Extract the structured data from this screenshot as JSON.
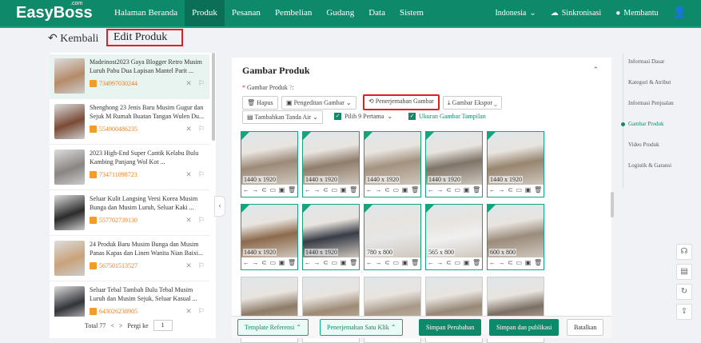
{
  "app": {
    "logo": "EasyBoss",
    "logo_sup": ".com"
  },
  "nav": [
    "Halaman Beranda",
    "Produk",
    "Pesanan",
    "Pembelian",
    "Gudang",
    "Data",
    "Sistem"
  ],
  "top_right": {
    "region": "Indonesia",
    "sync": "Sinkronisasi",
    "help": "Membantu"
  },
  "header": {
    "back": "Kembali",
    "title": "Edit Produk"
  },
  "products": [
    {
      "title": "Madeinost2023 Gaya Blogger Retro Musim Luruh Pabu Dua Lapisan Mantel Parit ...",
      "sku": "734997030244",
      "color": "#b58b6a"
    },
    {
      "title": "Shenghong 23 Jenis Baru Musim Gugur dan Sejuk M Rumah Buatan Tangan Wulen Du...",
      "sku": "554900486235",
      "color": "#7a4b36"
    },
    {
      "title": "2023 High-End Super Cantik Kelabu Bulu Kambing Panjang Wol Kot ...",
      "sku": "734711098723",
      "color": "#8a8583"
    },
    {
      "title": "Seluar Kulit Langsing Versi Korea Musim Bunga dan Musim Luruh, Seluar Kaki ...",
      "sku": "557702739130",
      "color": "#2b2b2b"
    },
    {
      "title": "24 Produk Baru Musim Bunga dan Musim Panas Kapas dan Linen Wanita Nian Baixi...",
      "sku": "567501513527",
      "color": "#c9a27a"
    },
    {
      "title": "Seluar Tebal Tambah Bulu Tebal Musim Luruh dan Musim Sejuk, Seluar Kasual ...",
      "sku": "643026238905",
      "color": "#33343a"
    }
  ],
  "pager": {
    "total": "Total 77",
    "goto": "Pergi ke",
    "page": "1"
  },
  "main": {
    "section_title": "Gambar Produk",
    "field_label": "Gambar Produk",
    "buttons": {
      "delete": "Hapus",
      "edit": "Pengeditan Gambar",
      "translate": "Penerjemahan Gambar",
      "export": "Gambar Ekspor",
      "watermark": "Tambahkan Tanda Air"
    },
    "checks": {
      "first9": "Pilih 9 Pertama",
      "show_size": "Ukuran Gambar Tampilan"
    },
    "images": [
      {
        "size": "1440 x 1920",
        "color": "#9c8a78"
      },
      {
        "size": "1440 x 1920",
        "color": "#8f7d6c"
      },
      {
        "size": "1440 x 1920",
        "color": "#a3927f"
      },
      {
        "size": "1440 x 1920",
        "color": "#7f7468"
      },
      {
        "size": "1440 x 1920",
        "color": "#97856f"
      },
      {
        "size": "1440 x 1920",
        "color": "#8c6a4c"
      },
      {
        "size": "1440 x 1920",
        "color": "#383c46"
      },
      {
        "size": "780 x 800",
        "color": "#e6e6e6"
      },
      {
        "size": "565 x 800",
        "color": "#f0f0f0"
      },
      {
        "size": "600 x 800",
        "color": "#9b8c7c"
      },
      {
        "size": "",
        "color": "#8e7b66"
      },
      {
        "size": "",
        "color": "#9e8a75"
      },
      {
        "size": "",
        "color": "#a89886"
      },
      {
        "size": "",
        "color": "#978876"
      },
      {
        "size": "",
        "color": "#7b6f63"
      }
    ]
  },
  "footer": {
    "template": "Template Referensi",
    "one_click": "Penerjemahan Satu Klik",
    "save": "Simpan Perubahan",
    "save_publish": "Simpan dan publikasi",
    "cancel": "Batalkan"
  },
  "right_nav": [
    "Informasi Dasar",
    "Kategori & Atribut",
    "Informasi Penjualan",
    "Gambar Produk",
    "Video Produk",
    "Logistik & Garansi"
  ]
}
